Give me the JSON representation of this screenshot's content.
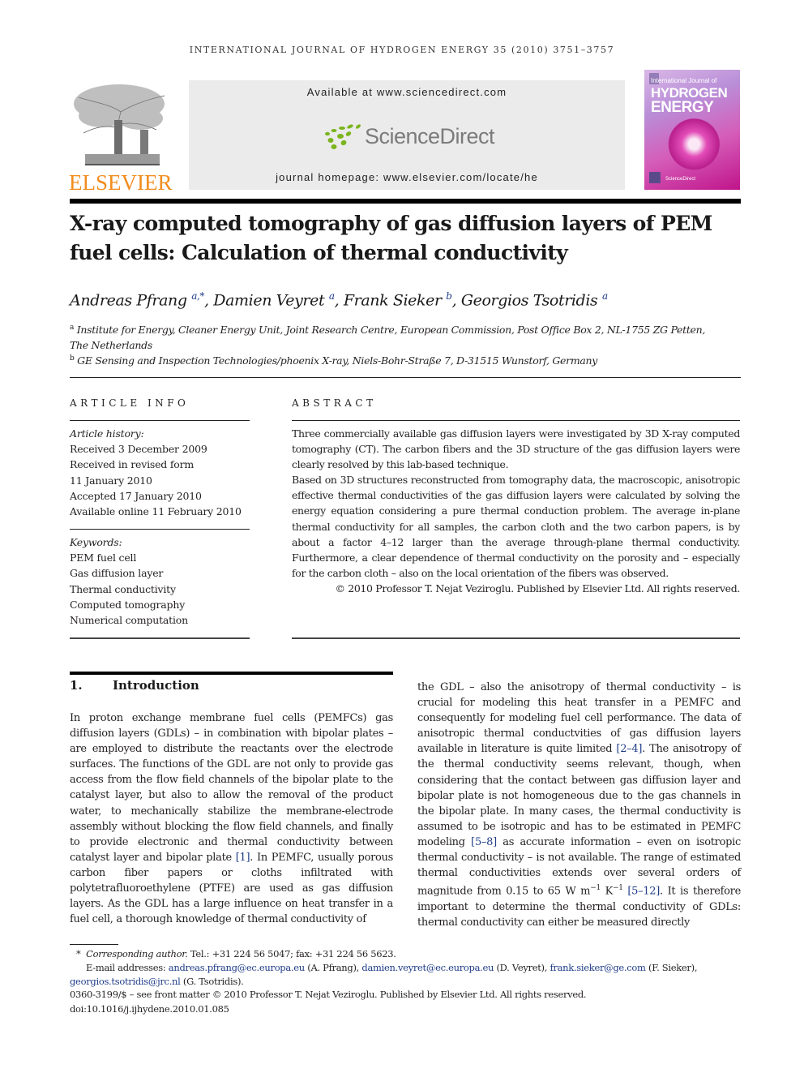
{
  "running_head": "INTERNATIONAL JOURNAL OF HYDROGEN ENERGY 35 (2010) 3751–3757",
  "masthead": {
    "available_at": "Available at www.sciencedirect.com",
    "sciencedirect_logo": "ScienceDirect",
    "journal_homepage": "journal homepage: www.elsevier.com/locate/he",
    "publisher_logo": "ELSEVIER",
    "cover": {
      "line1": "International Journal of",
      "line2": "HYDROGEN",
      "line3": "ENERGY",
      "footer": "ScienceDirect"
    },
    "colors": {
      "elsevier_orange": "#f28c1e",
      "sciencedirect_green": "#7ab51d",
      "cover_magenta": "#c0148a"
    }
  },
  "article": {
    "title_line1": "X-ray computed tomography of gas diffusion layers of PEM",
    "title_line2": "fuel cells: Calculation of thermal conductivity",
    "authors": [
      {
        "name": "Andreas Pfrang",
        "sup": "a,*"
      },
      {
        "name": "Damien Veyret",
        "sup": "a"
      },
      {
        "name": "Frank Sieker",
        "sup": "b"
      },
      {
        "name": "Georgios Tsotridis",
        "sup": "a"
      }
    ],
    "affiliations": [
      {
        "label": "a",
        "line1": "Institute for Energy, Cleaner Energy Unit, Joint Research Centre, European Commission, Post Office Box 2, NL-1755 ZG Petten,",
        "line2": "The Netherlands"
      },
      {
        "label": "b",
        "line1": "GE Sensing and Inspection Technologies/phoenix X-ray, Niels-Bohr-Straße 7, D-31515 Wunstorf, Germany"
      }
    ]
  },
  "article_info": {
    "heading": "ARTICLE INFO",
    "history_label": "Article history:",
    "history": [
      "Received 3 December 2009",
      "Received in revised form",
      "11 January 2010",
      "Accepted 17 January 2010",
      "Available online 11 February 2010"
    ],
    "keywords_label": "Keywords:",
    "keywords": [
      "PEM fuel cell",
      "Gas diffusion layer",
      "Thermal conductivity",
      "Computed tomography",
      "Numerical computation"
    ]
  },
  "abstract": {
    "heading": "ABSTRACT",
    "paragraph1": "Three commercially available gas diffusion layers were investigated by 3D X-ray computed tomography (CT). The carbon fibers and the 3D structure of the gas diffusion layers were clearly resolved by this lab-based technique.",
    "paragraph2": "Based on 3D structures reconstructed from tomography data, the macroscopic, anisotropic effective thermal conductivities of the gas diffusion layers were calculated by solving the energy equation considering a pure thermal conduction problem. The average in-plane thermal conductivity for all samples, the carbon cloth and the two carbon papers, is by about a factor 4–12 larger than the average through-plane thermal conductivity. Furthermore, a clear dependence of thermal conductivity on the porosity and – especially for the carbon cloth – also on the local orientation of the fibers was observed.",
    "copyright": "© 2010 Professor T. Nejat Veziroglu. Published by Elsevier Ltd. All rights reserved."
  },
  "introduction": {
    "number": "1.",
    "heading": "Introduction",
    "left_col": {
      "p1": "In proton exchange membrane fuel cells (PEMFCs) gas diffusion layers (GDLs) – in combination with bipolar plates – are employed to distribute the reactants over the electrode surfaces. The functions of the GDL are not only to provide gas access from the flow field channels of the bipolar plate to the catalyst layer, but also to allow the removal of the product water, to mechanically stabilize the membrane-electrode assembly without blocking the flow field channels, and finally to provide electronic and thermal conductivity between catalyst layer and bipolar plate",
      "ref1": "[1]",
      "p2": ". In PEMFC, usually porous carbon fiber papers or cloths infiltrated with polytetrafluoroethylene (PTFE) are used as gas diffusion layers. As the GDL has a large influence on heat transfer in a fuel cell, a thorough knowledge of thermal conductivity of"
    },
    "right_col": {
      "s1": "the GDL – also the anisotropy of thermal conductivity – is crucial for modeling this heat transfer in a PEMFC and consequently for modeling fuel cell performance. The data of anisotropic thermal conductvities of gas diffusion layers available in literature is quite limited ",
      "ref1": "[2–4]",
      "s2": ". The anisotropy of the thermal conductivity seems relevant, though, when considering that the contact between gas diffusion layer and bipolar plate is not homogeneous due to the gas channels in the bipolar plate. In many cases, the thermal conductivity is assumed to be isotropic and has to be estimated in PEMFC modeling ",
      "ref2": "[5–8]",
      "s3": " as accurate information – even on isotropic thermal conductivity – is not available. The range of estimated thermal conductivities extends over several orders of magnitude from 0.15 to 65 W m",
      "exp1": "−1",
      "unit2": " K",
      "exp2": "−1",
      "s4": " ",
      "ref3": "[5–12]",
      "s5": ". It is therefore important to determine the thermal conductivity of GDLs: thermal conductivity can either be measured directly"
    }
  },
  "footnotes": {
    "corresponding_marker": "*",
    "corresponding_label": "Corresponding author.",
    "corresponding_contact": " Tel.: +31 224 56 5047; fax: +31 224 56 5623.",
    "email_label": "E-mail addresses: ",
    "emails": [
      {
        "address": "andreas.pfrang@ec.europa.eu",
        "who": " (A. Pfrang), "
      },
      {
        "address": "damien.veyret@ec.europa.eu",
        "who": " (D. Veyret), "
      },
      {
        "address": "frank.sieker@ge.com",
        "who": " (F. Sieker), "
      },
      {
        "address": "georgios.tsotridis@jrc.nl",
        "who": " (G. Tsotridis)."
      }
    ],
    "front_matter": "0360-3199/$ – see front matter © 2010 Professor T. Nejat Veziroglu. Published by Elsevier Ltd. All rights reserved.",
    "doi": "doi:10.1016/j.ijhydene.2010.01.085"
  }
}
